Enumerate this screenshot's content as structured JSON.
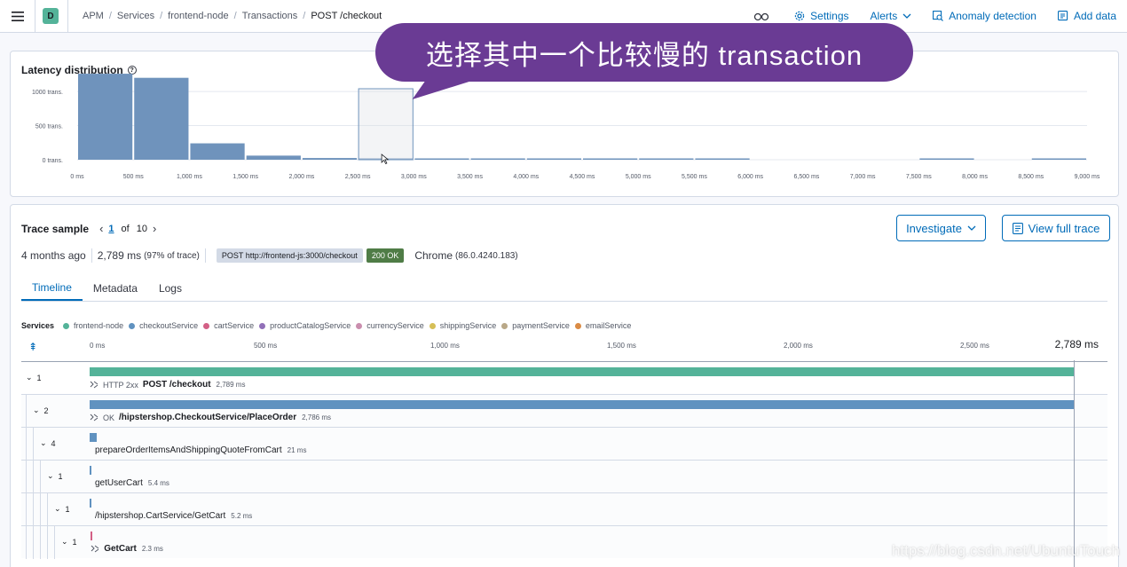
{
  "header": {
    "space_letter": "D",
    "breadcrumbs": [
      "APM",
      "Services",
      "frontend-node",
      "Transactions",
      "POST /checkout"
    ],
    "settings_label": "Settings",
    "alerts_label": "Alerts",
    "anomaly_label": "Anomaly detection",
    "add_data_label": "Add data"
  },
  "callout": {
    "text": "选择其中一个比较慢的 transaction"
  },
  "latency": {
    "title": "Latency distribution"
  },
  "chart_data": {
    "type": "bar",
    "title": "Latency distribution",
    "xlabel": "",
    "ylabel": "",
    "x_ticks": [
      "0 ms",
      "500 ms",
      "1,000 ms",
      "1,500 ms",
      "2,000 ms",
      "2,500 ms",
      "3,000 ms",
      "3,500 ms",
      "4,000 ms",
      "4,500 ms",
      "5,000 ms",
      "5,500 ms",
      "6,000 ms",
      "6,500 ms",
      "7,000 ms",
      "7,500 ms",
      "8,000 ms",
      "8,500 ms",
      "9,000 ms"
    ],
    "y_ticks": [
      "0 trans.",
      "500 trans.",
      "1000 trans."
    ],
    "xlim": [
      0,
      9000
    ],
    "ylim": [
      0,
      1300
    ],
    "bucket_size_ms": 500,
    "bucket_starts_ms": [
      0,
      500,
      1000,
      1500,
      2000,
      2500,
      3000,
      3500,
      4000,
      4500,
      5000,
      5500,
      7500,
      8500
    ],
    "values": [
      1260,
      1200,
      240,
      60,
      25,
      10,
      15,
      10,
      8,
      6,
      6,
      5,
      5,
      5
    ],
    "selected_bucket_start_ms": 2500
  },
  "trace": {
    "title": "Trace sample",
    "page_current": "1",
    "page_of": "of",
    "page_total": "10",
    "investigate_label": "Investigate",
    "view_full_trace_label": "View full trace",
    "age": "4 months ago",
    "duration": "2,789 ms",
    "duration_pct": "(97% of trace)",
    "url": "POST http://frontend-js:3000/checkout",
    "status": "200 OK",
    "browser": "Chrome",
    "browser_version": "(86.0.4240.183)",
    "tabs": [
      "Timeline",
      "Metadata",
      "Logs"
    ],
    "services_label": "Services",
    "services": [
      {
        "name": "frontend-node",
        "color": "#54b399"
      },
      {
        "name": "checkoutService",
        "color": "#6092c0"
      },
      {
        "name": "cartService",
        "color": "#d36086"
      },
      {
        "name": "productCatalogService",
        "color": "#9170b8"
      },
      {
        "name": "currencyService",
        "color": "#ca8eae"
      },
      {
        "name": "shippingService",
        "color": "#d6bf57"
      },
      {
        "name": "paymentService",
        "color": "#b9a888"
      },
      {
        "name": "emailService",
        "color": "#da8b45"
      }
    ],
    "timeline_ticks": [
      "0 ms",
      "500 ms",
      "1,000 ms",
      "1,500 ms",
      "2,000 ms",
      "2,500 ms"
    ],
    "timeline_total": "2,789 ms",
    "rows": [
      {
        "count": "1",
        "pre": "HTTP 2xx",
        "name": "POST /checkout",
        "dur": "2,789 ms",
        "start_ms": 0,
        "dur_ms": 2789,
        "color": "#54b399",
        "bold": true,
        "icon": true
      },
      {
        "count": "2",
        "pre": "OK",
        "name": "/hipstershop.CheckoutService/PlaceOrder",
        "dur": "2,786 ms",
        "start_ms": 0,
        "dur_ms": 2786,
        "color": "#6092c0",
        "bold": true,
        "icon": true
      },
      {
        "count": "4",
        "pre": "",
        "name": "prepareOrderItemsAndShippingQuoteFromCart",
        "dur": "21 ms",
        "start_ms": 0,
        "dur_ms": 21,
        "color": "#6092c0",
        "bold": false,
        "icon": false
      },
      {
        "count": "1",
        "pre": "",
        "name": "getUserCart",
        "dur": "5.4 ms",
        "start_ms": 0,
        "dur_ms": 5.4,
        "color": "#6092c0",
        "bold": false,
        "icon": false
      },
      {
        "count": "1",
        "pre": "",
        "name": "/hipstershop.CartService/GetCart",
        "dur": "5.2 ms",
        "start_ms": 0,
        "dur_ms": 5.2,
        "color": "#6092c0",
        "bold": false,
        "icon": false
      },
      {
        "count": "1",
        "pre": "",
        "name": "GetCart",
        "dur": "2.3 ms",
        "start_ms": 3,
        "dur_ms": 2.3,
        "color": "#d36086",
        "bold": true,
        "icon": true
      }
    ]
  },
  "watermark": "https://blog.csdn.net/UbuntuTouch"
}
